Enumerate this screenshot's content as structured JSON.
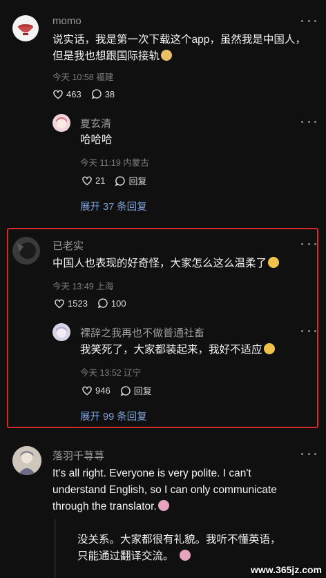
{
  "comments": [
    {
      "user": "momo",
      "text": "说实话，我是第一次下载这个app，虽然我是中国人，但是我也想跟国际接轨",
      "meta": "今天 10:58 福建",
      "likes": "463",
      "replies": "38",
      "reply": {
        "user": "夏玄清",
        "text": "哈哈哈",
        "meta": "今天 11:19 内蒙古",
        "likes": "21",
        "reply_label": "回复"
      },
      "expand": "展开 37 条回复"
    },
    {
      "user": "已老实",
      "text": "中国人也表现的好奇怪，大家怎么这么温柔了",
      "meta": "今天 13:49 上海",
      "likes": "1523",
      "replies": "100",
      "reply": {
        "user": "裸辞之我再也不做普通社畜",
        "text": "我笑死了，大家都装起来，我好不适应",
        "meta": "今天 13:52 辽宁",
        "likes": "946",
        "reply_label": "回复"
      },
      "expand": "展开 99 条回复"
    },
    {
      "user": "落羽千荨荨",
      "text_lines": [
        "It's all right. Everyone is very polite. I can't",
        "understand English, so I can only communicate",
        "through the translator."
      ],
      "translation_lines": [
        "没关系。大家都很有礼貌。我听不懂英语，",
        "只能通过翻译交流。"
      ]
    }
  ],
  "watermark": "www.365jz.com",
  "colors": {
    "background": "#101010",
    "highlight_border": "#d42a2a",
    "link": "#7ea3d8"
  },
  "icons": [
    "heart-icon",
    "comment-icon",
    "more-dots-icon",
    "emoji-icon"
  ]
}
